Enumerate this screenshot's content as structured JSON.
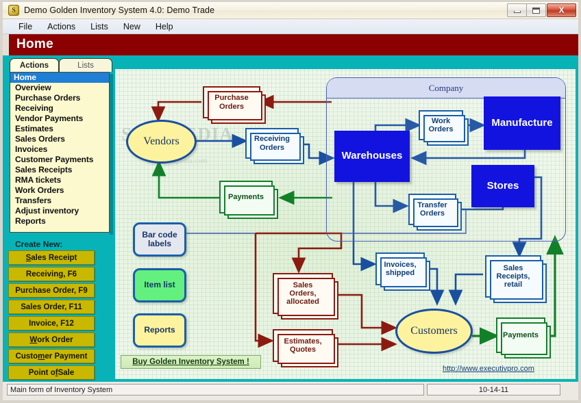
{
  "window": {
    "title": "Demo Golden Inventory System 4.0: Demo Trade",
    "icon": "app-gold-coin-icon",
    "minimize_label": "Minimize",
    "maximize_label": "Maximize",
    "close_label": "X"
  },
  "menu": {
    "items": [
      "File",
      "Actions",
      "Lists",
      "New",
      "Help"
    ]
  },
  "header": {
    "title": "Home"
  },
  "tabs": [
    {
      "label": "Actions",
      "active": true
    },
    {
      "label": "Lists",
      "active": false
    }
  ],
  "sidebar": {
    "nav_items": [
      {
        "label": "Home",
        "selected": true
      },
      {
        "label": "Overview",
        "selected": false
      },
      {
        "label": "Purchase Orders",
        "selected": false
      },
      {
        "label": "Receiving",
        "selected": false
      },
      {
        "label": "Vendor Payments",
        "selected": false
      },
      {
        "label": "Estimates",
        "selected": false
      },
      {
        "label": "Sales Orders",
        "selected": false
      },
      {
        "label": "Invoices",
        "selected": false
      },
      {
        "label": "Customer Payments",
        "selected": false
      },
      {
        "label": "Sales Receipts",
        "selected": false
      },
      {
        "label": "RMA tickets",
        "selected": false
      },
      {
        "label": "Work Orders",
        "selected": false
      },
      {
        "label": "Transfers",
        "selected": false
      },
      {
        "label": "Adjust inventory",
        "selected": false
      },
      {
        "label": "Reports",
        "selected": false
      }
    ],
    "create_new_label": "Create New:",
    "create_buttons": [
      {
        "label": "Sales Receipt",
        "accel": "S"
      },
      {
        "label": "Receiving, F6",
        "accel": ""
      },
      {
        "label": "Purchase Order, F9",
        "accel": ""
      },
      {
        "label": "Sales Order, F11",
        "accel": ""
      },
      {
        "label": "Invoice, F12",
        "accel": ""
      },
      {
        "label": "Work Order",
        "accel": "W"
      },
      {
        "label": "Customer Payment",
        "accel": "m"
      },
      {
        "label": "Point of Sale",
        "accel": "f"
      }
    ]
  },
  "diagram": {
    "watermark_line1": "SOFTPEDIA",
    "watermark_line2": "www.softpedia.com",
    "company_panel_label": "Company",
    "buy_link": "Buy Golden Inventory  System !",
    "site_link": "http://www.executivpro.com",
    "nodes": [
      {
        "id": "purchase-orders",
        "label": "Purchase\nOrders",
        "style": "doc-red"
      },
      {
        "id": "vendors",
        "label": "Vendors",
        "style": "ellipse-yellow"
      },
      {
        "id": "receiving-orders",
        "label": "Receiving\nOrders",
        "style": "doc-blue"
      },
      {
        "id": "payments-vendor",
        "label": "Payments",
        "style": "doc-green"
      },
      {
        "id": "warehouses",
        "label": "Warehouses",
        "style": "solid-blue"
      },
      {
        "id": "work-orders",
        "label": "Work\nOrders",
        "style": "doc-blue"
      },
      {
        "id": "manufacture",
        "label": "Manufacture",
        "style": "solid-blue"
      },
      {
        "id": "stores",
        "label": "Stores",
        "style": "solid-blue"
      },
      {
        "id": "transfer-orders",
        "label": "Transfer\nOrders",
        "style": "doc-blue"
      },
      {
        "id": "bar-code-labels",
        "label": "Bar code\nlabels",
        "style": "round-grey"
      },
      {
        "id": "item-list",
        "label": "Item list",
        "style": "round-green"
      },
      {
        "id": "reports",
        "label": "Reports",
        "style": "round-yellow"
      },
      {
        "id": "sales-orders-allocated",
        "label": "Sales\nOrders,\nallocated",
        "style": "doc-red"
      },
      {
        "id": "estimates-quotes",
        "label": "Estimates,\nQuotes",
        "style": "doc-red"
      },
      {
        "id": "invoices-shipped",
        "label": "Invoices,\nshipped",
        "style": "doc-blue"
      },
      {
        "id": "sales-receipts-retail",
        "label": "Sales\nReceipts,\nretail",
        "style": "doc-blue"
      },
      {
        "id": "customers",
        "label": "Customers",
        "style": "ellipse-yellow"
      },
      {
        "id": "payments-customer",
        "label": "Payments",
        "style": "doc-green"
      }
    ]
  },
  "statusbar": {
    "message": "Main form of Inventory System",
    "date": "10-14-11"
  },
  "colors": {
    "header_red": "#8b0000",
    "teal": "#08b3b8",
    "nav_selected": "#1f7fd4",
    "button_gold": "#c9b800",
    "node_solid_blue": "#1313e0",
    "arrow_blue": "#1a4fa0",
    "arrow_red": "#8b1a10",
    "arrow_green": "#128029"
  }
}
